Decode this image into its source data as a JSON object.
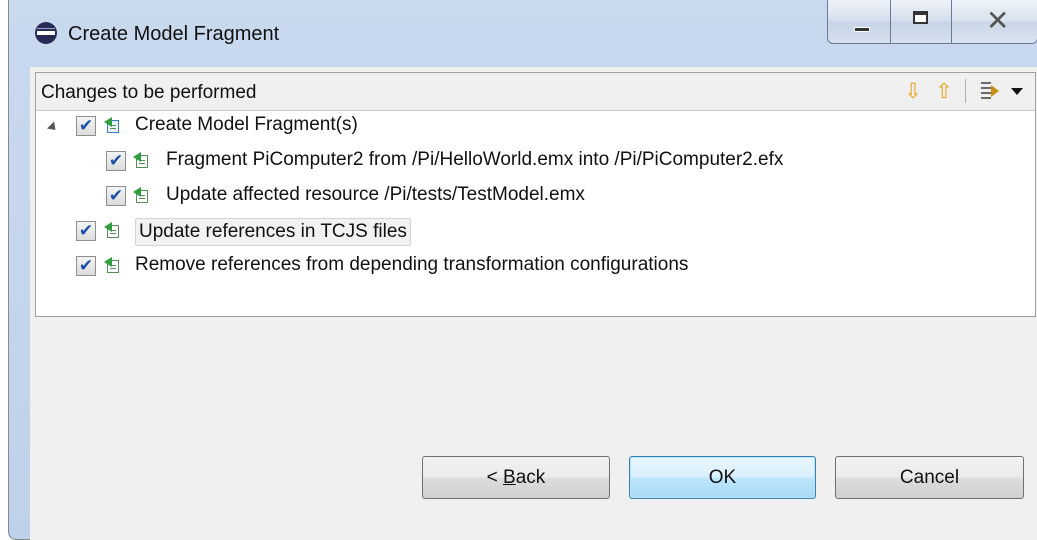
{
  "window": {
    "title": "Create Model Fragment",
    "icon": "eclipse-icon"
  },
  "panel": {
    "title": "Changes to be performed",
    "toolbar": {
      "next": "down-arrow-icon",
      "previous": "up-arrow-icon",
      "filter": "filter-changes-icon",
      "menu": "view-menu-icon"
    }
  },
  "tree": {
    "root": {
      "label": "Create Model Fragment(s)",
      "checked": true,
      "expanded": true
    },
    "root_children": [
      {
        "label": "Fragment PiComputer2 from /Pi/HelloWorld.emx into /Pi/PiComputer2.efx",
        "checked": true
      },
      {
        "label": "Update affected resource /Pi/tests/TestModel.emx",
        "checked": true
      }
    ],
    "top_level": [
      {
        "label": "Update references in TCJS files",
        "checked": true,
        "highlighted": true
      },
      {
        "label": "Remove references from depending transformation configurations",
        "checked": true
      }
    ],
    "check_glyph": "✔"
  },
  "buttons": {
    "back_prefix": "< ",
    "back_mnemonic": "B",
    "back_rest": "ack",
    "ok": "OK",
    "cancel": "Cancel"
  }
}
